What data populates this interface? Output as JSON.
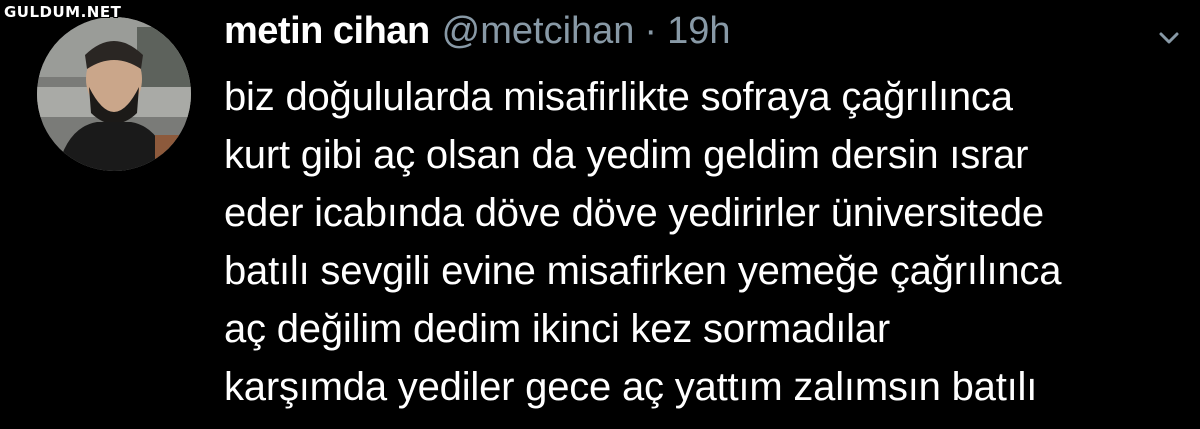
{
  "watermark": {
    "text": "GULDUM.NET"
  },
  "tweet": {
    "display_name": "metin cihan",
    "handle": "@metcihan",
    "separator": "·",
    "time": "19h",
    "lines": [
      "biz doğulularda misafirlikte sofraya çağrılınca",
      "kurt gibi aç olsan da yedim geldim dersin ısrar",
      "eder icabında döve döve yedirirler üniversitede",
      "batılı sevgili evine misafirken yemeğe çağrılınca",
      "aç değilim dedim ikinci kez sormadılar",
      "karşımda yediler gece aç yattım zalımsın batılı"
    ],
    "menu_icon": "chevron-down-icon",
    "avatar_icon": "avatar"
  },
  "colors": {
    "background": "#000000",
    "text": "#ffffff",
    "secondary": "#8899a6"
  }
}
